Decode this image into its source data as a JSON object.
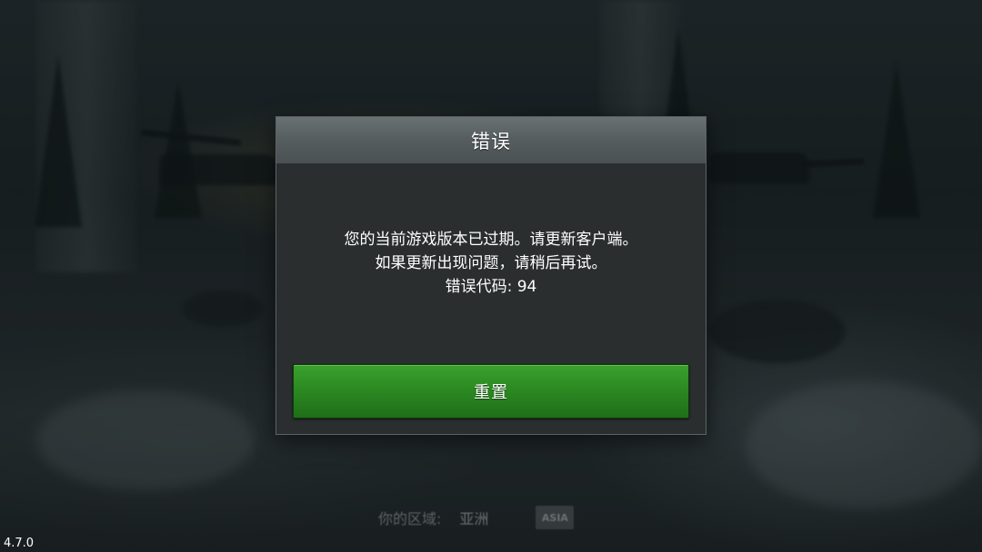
{
  "dialog": {
    "title": "错误",
    "message_lines": [
      "您的当前游戏版本已过期。请更新客户端。",
      "如果更新出现问题，请稍后再试。",
      "错误代码: 94"
    ],
    "button_label": "重置"
  },
  "region": {
    "label": "你的区域:",
    "value": "亚洲",
    "badge": "ASIA"
  },
  "version": "4.7.0",
  "colors": {
    "button_green": "#2c8a22",
    "header_gray": "#5a6163",
    "body_dark": "#2a2e2f"
  }
}
